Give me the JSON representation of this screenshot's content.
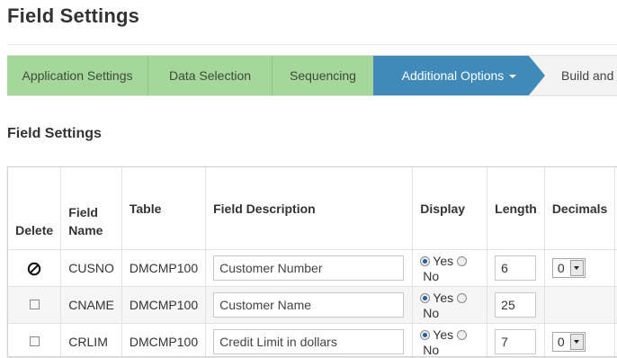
{
  "page": {
    "title": "Field Settings"
  },
  "wizard": {
    "steps": [
      {
        "label": "Application Settings",
        "state": "done"
      },
      {
        "label": "Data Selection",
        "state": "done"
      },
      {
        "label": "Sequencing",
        "state": "done"
      },
      {
        "label": "Additional Options",
        "state": "active"
      },
      {
        "label": "Build and G",
        "state": "future"
      }
    ]
  },
  "section": {
    "title": "Field Settings"
  },
  "table": {
    "headers": {
      "delete": "Delete",
      "field_name_1": "Field",
      "field_name_2": "Name",
      "table": "Table",
      "description": "Field Description",
      "display": "Display",
      "length": "Length",
      "decimals": "Decimals"
    },
    "rows": [
      {
        "field_name": "CUSNO",
        "table": "DMCMP100",
        "description": "Customer Number",
        "display": "Yes",
        "length": "6",
        "decimals": "0",
        "delete_locked": true
      },
      {
        "field_name": "CNAME",
        "table": "DMCMP100",
        "description": "Customer Name",
        "display": "Yes",
        "length": "25",
        "decimals": "",
        "delete_locked": false
      },
      {
        "field_name": "CRLIM",
        "table": "DMCMP100",
        "description": "Credit Limit in dollars",
        "display": "Yes",
        "length": "7",
        "decimals": "0",
        "delete_locked": false
      }
    ],
    "radio_labels": {
      "yes": "Yes",
      "no": "No"
    }
  },
  "colors": {
    "step_done": "#a6d79a",
    "step_active": "#3f8ab9",
    "radio_selected": "#1f5f9e"
  },
  "icons": {
    "locked_delete": "prohibited-icon",
    "dropdown": "chevron-down-icon"
  }
}
